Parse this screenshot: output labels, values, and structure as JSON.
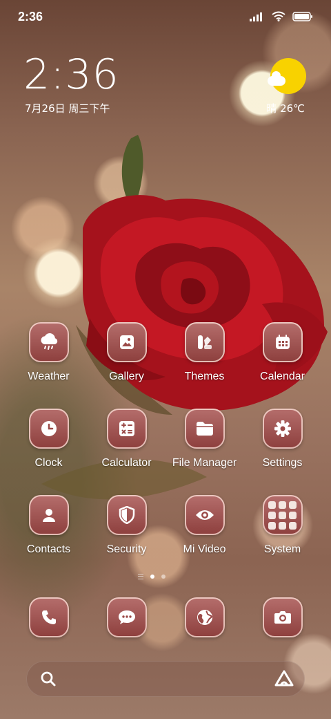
{
  "status_bar": {
    "time": "2:36"
  },
  "lockwidget": {
    "time": "2:36",
    "date": "7月26日 周三下午"
  },
  "weather_widget": {
    "condition": "晴",
    "temperature": "26℃"
  },
  "apps": [
    {
      "label": "Weather",
      "icon": "weather-icon"
    },
    {
      "label": "Gallery",
      "icon": "gallery-icon"
    },
    {
      "label": "Themes",
      "icon": "themes-icon"
    },
    {
      "label": "Calendar",
      "icon": "calendar-icon"
    },
    {
      "label": "Clock",
      "icon": "clock-icon"
    },
    {
      "label": "Calculator",
      "icon": "calculator-icon"
    },
    {
      "label": "File Manager",
      "icon": "folder-icon"
    },
    {
      "label": "Settings",
      "icon": "gear-icon"
    },
    {
      "label": "Contacts",
      "icon": "contacts-icon"
    },
    {
      "label": "Security",
      "icon": "shield-icon"
    },
    {
      "label": "Mi Video",
      "icon": "eye-icon"
    },
    {
      "label": "System",
      "icon": "folder-grid-icon"
    }
  ],
  "dock": [
    {
      "icon": "phone-icon"
    },
    {
      "icon": "message-icon"
    },
    {
      "icon": "browser-icon"
    },
    {
      "icon": "camera-icon"
    }
  ],
  "pager": {
    "pages": 2,
    "active": 1
  },
  "colors": {
    "tile_top": "#b56e6c",
    "tile_bottom": "#8d3f3d",
    "sun": "#f8d200"
  }
}
